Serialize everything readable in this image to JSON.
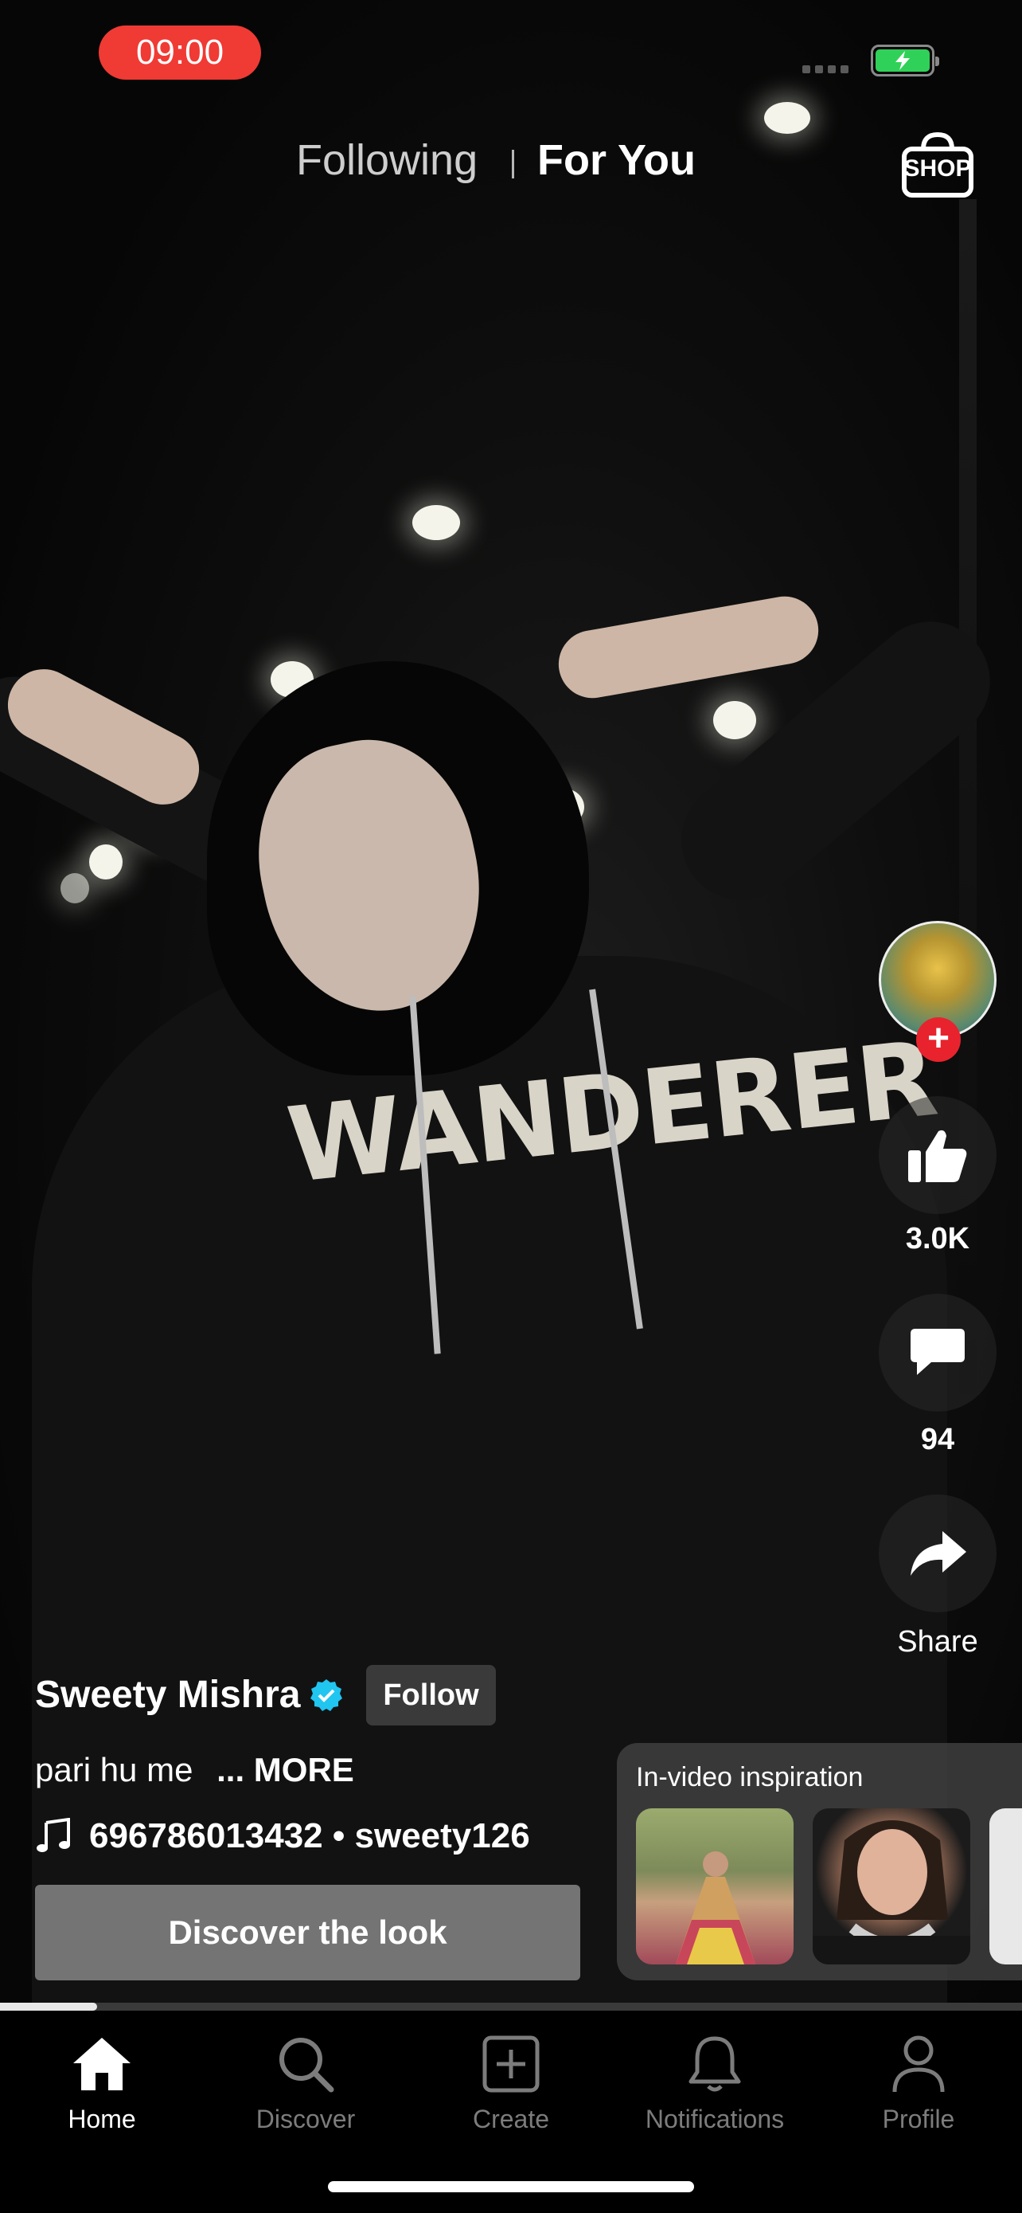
{
  "status_bar": {
    "time": "09:00",
    "battery_state": "charging",
    "battery_color": "#30d158",
    "time_pill_color": "#f03a34"
  },
  "top_tabs": {
    "following": "Following",
    "for_you": "For You",
    "selected": "For You",
    "shop_label": "SHOP"
  },
  "video": {
    "shirt_text": "WANDERER",
    "progress": 0.095
  },
  "right_rail": {
    "follow_badge": "+",
    "like_count": "3.0K",
    "comment_count": "94",
    "share_label": "Share",
    "icons": [
      "thumbs-up-icon",
      "comment-icon",
      "share-icon"
    ]
  },
  "creator": {
    "name": "Sweety Mishra",
    "verified": true,
    "follow_label": "Follow",
    "verified_color": "#20c5f0"
  },
  "caption": {
    "text": "pari hu me",
    "more": "... MORE"
  },
  "music": {
    "text": "696786013432 • sweety126"
  },
  "discover_look": {
    "label": "Discover the look"
  },
  "inspiration": {
    "title": "In-video inspiration"
  },
  "nav": {
    "items": [
      {
        "label": "Home",
        "icon": "home-icon",
        "active": true
      },
      {
        "label": "Discover",
        "icon": "search-icon",
        "active": false
      },
      {
        "label": "Create",
        "icon": "create-icon",
        "active": false
      },
      {
        "label": "Notifications",
        "icon": "bell-icon",
        "active": false
      },
      {
        "label": "Profile",
        "icon": "profile-icon",
        "active": false
      }
    ]
  }
}
